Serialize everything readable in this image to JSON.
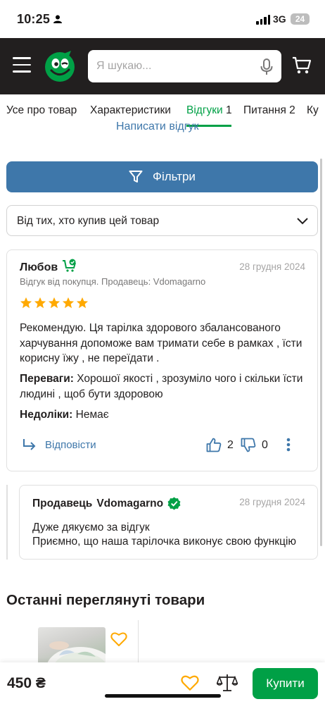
{
  "status_bar": {
    "time": "10:25",
    "network": "3G",
    "battery": "24"
  },
  "header": {
    "search_placeholder": "Я шукаю...",
    "logo_icon": "rozetka-smile-logo",
    "colors": {
      "header_bg": "#221f1f",
      "brand_green": "#00a046",
      "link_blue": "#3e77aa"
    }
  },
  "tabs": [
    {
      "label": "Усе про товар",
      "count": ""
    },
    {
      "label": "Характеристики",
      "count": ""
    },
    {
      "label": "Відгуки",
      "count": "1",
      "active": true
    },
    {
      "label": "Питання",
      "count": "2"
    },
    {
      "label": "Ку",
      "count": ""
    }
  ],
  "write_review_label": "Написати відгук",
  "filter_button_label": "Фільтри",
  "filter_select_value": "Від тих, хто купив цей товар",
  "review": {
    "author": "Любов",
    "date": "28 грудня 2024",
    "meta": "Відгук від покупця. Продавець: Vdomagarno",
    "rating": 5,
    "text": "Рекомендую. Ця тарілка здорового збалансованого харчування допоможе вам тримати себе в рамках , їсти корисну їжу , не переїдати .",
    "pros_label": "Переваги:",
    "pros": "Хорошої якості , зрозуміло чого і скільки їсти людині , щоб бути здоровою",
    "cons_label": "Недоліки:",
    "cons": "Немає",
    "reply_label": "Відповісти",
    "likes": "2",
    "dislikes": "0"
  },
  "seller_reply": {
    "prefix": "Продавець",
    "name": "Vdomagarno",
    "date": "28 грудня 2024",
    "line1": "Дуже дякуємо за відгук",
    "line2": "Приємно, що наша тарілочка виконує свою функцію"
  },
  "recent": {
    "title": "Останні переглянуті товари"
  },
  "bottom_bar": {
    "price": "450 ₴",
    "buy_label": "Купити"
  }
}
